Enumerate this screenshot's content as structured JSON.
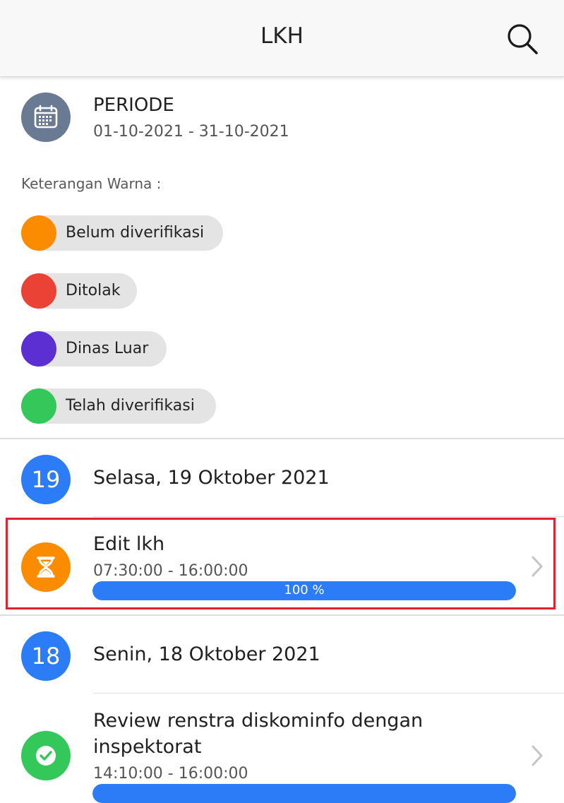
{
  "header": {
    "title": "LKH"
  },
  "periode": {
    "title": "PERIODE",
    "range": "01-10-2021 - 31-10-2021"
  },
  "legend": {
    "label": "Keterangan Warna :",
    "items": [
      {
        "label": "Belum diverifikasi",
        "color": "#fb8c00"
      },
      {
        "label": "Ditolak",
        "color": "#ea4335"
      },
      {
        "label": "Dinas Luar",
        "color": "#5b2fd1"
      },
      {
        "label": "Telah diverifikasi",
        "color": "#34c759"
      }
    ]
  },
  "days": [
    {
      "day_number": "19",
      "date_label": "Selasa, 19 Oktober 2021",
      "entries": [
        {
          "title": "Edit lkh",
          "time": "07:30:00 - 16:00:00",
          "progress_text": "100 %",
          "progress_value": 100,
          "status": "Belum diverifikasi",
          "icon": "hourglass-icon",
          "color": "#fb8c00"
        }
      ]
    },
    {
      "day_number": "18",
      "date_label": "Senin, 18 Oktober 2021",
      "entries": [
        {
          "title_line1": "Review renstra diskominfo dengan",
          "title_line2": "inspektorat",
          "time": "14:10:00 - 16:00:00",
          "status": "Telah diverifikasi",
          "icon": "check-icon",
          "color": "#34c759"
        }
      ]
    }
  ]
}
